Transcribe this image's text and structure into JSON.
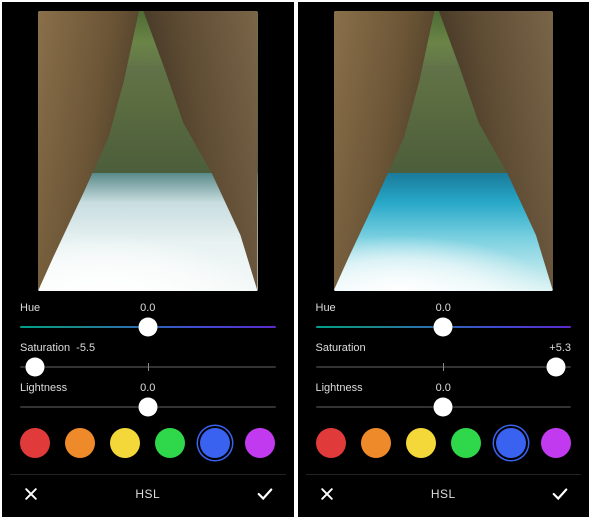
{
  "left": {
    "hue": {
      "label": "Hue",
      "value": "0.0",
      "thumb_percent": 50
    },
    "saturation": {
      "label": "Saturation",
      "value": "-5.5",
      "thumb_percent": 6,
      "value_align": "left-after-label"
    },
    "lightness": {
      "label": "Lightness",
      "value": "0.0",
      "thumb_percent": 50
    },
    "swatches": [
      {
        "name": "red",
        "color": "#e03a3a",
        "selected": false
      },
      {
        "name": "orange",
        "color": "#ef8a2b",
        "selected": false
      },
      {
        "name": "yellow",
        "color": "#f4d83a",
        "selected": false
      },
      {
        "name": "green",
        "color": "#2fd84a",
        "selected": false
      },
      {
        "name": "blue",
        "color": "#3a62f0",
        "selected": true
      },
      {
        "name": "magenta",
        "color": "#c23af0",
        "selected": false
      }
    ],
    "mode": "HSL",
    "cancel_icon": "close-icon",
    "confirm_icon": "check-icon"
  },
  "right": {
    "hue": {
      "label": "Hue",
      "value": "0.0",
      "thumb_percent": 50
    },
    "saturation": {
      "label": "Saturation",
      "value": "+5.3",
      "thumb_percent": 94,
      "value_align": "right"
    },
    "lightness": {
      "label": "Lightness",
      "value": "0.0",
      "thumb_percent": 50
    },
    "swatches": [
      {
        "name": "red",
        "color": "#e03a3a",
        "selected": false
      },
      {
        "name": "orange",
        "color": "#ef8a2b",
        "selected": false
      },
      {
        "name": "yellow",
        "color": "#f4d83a",
        "selected": false
      },
      {
        "name": "green",
        "color": "#2fd84a",
        "selected": false
      },
      {
        "name": "blue",
        "color": "#3a62f0",
        "selected": true
      },
      {
        "name": "magenta",
        "color": "#c23af0",
        "selected": false
      }
    ],
    "mode": "HSL",
    "cancel_icon": "close-icon",
    "confirm_icon": "check-icon"
  }
}
